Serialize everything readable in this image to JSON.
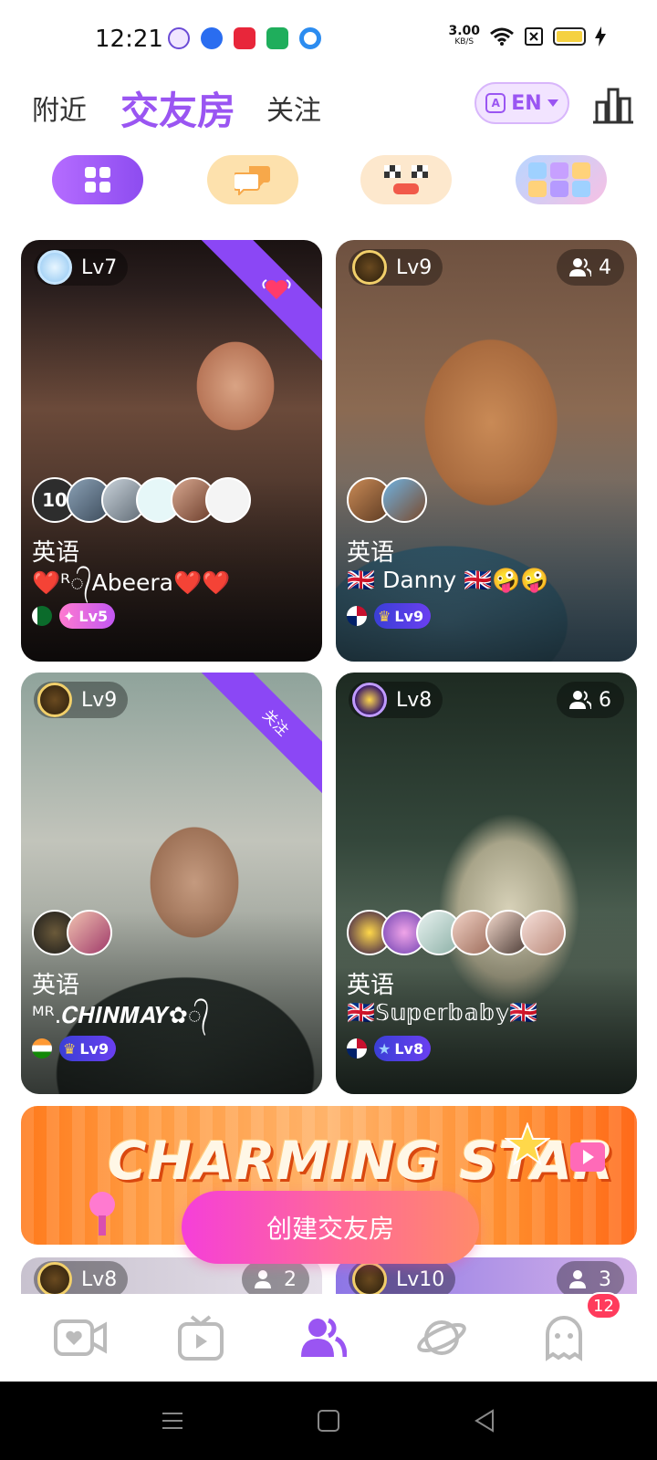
{
  "status_bar": {
    "time": "12:21",
    "net_speed": "3.00",
    "net_unit": "KB/S",
    "icons": [
      "app-notification-icon",
      "baidu-icon",
      "video-app-icon",
      "shield-app-icon",
      "chat-app-icon",
      "wifi-icon",
      "sim-icon",
      "battery-icon",
      "charging-icon"
    ]
  },
  "top_nav": {
    "tabs": [
      {
        "label": "附近"
      },
      {
        "label": "交友房"
      },
      {
        "label": "关注"
      }
    ],
    "active_tab": "交友房",
    "language_label": "EN",
    "accent_color": "#9a55f2"
  },
  "chips": [
    {
      "icon": "grid-icon"
    },
    {
      "icon": "chat-bubbles-icon"
    },
    {
      "icon": "racing-flags-icon"
    },
    {
      "icon": "number-puzzle-icon"
    }
  ],
  "rooms": [
    {
      "level": "Lv7",
      "ribbon": "",
      "members_overflow": "10",
      "language": "英语",
      "name": "❤️ᴿ᭄Abeera❤️❤️",
      "host_level": "Lv5"
    },
    {
      "level": "Lv9",
      "count": "4",
      "language": "英语",
      "name": "🇬🇧 Danny 🇬🇧🤪🤪",
      "host_level": "Lv9"
    },
    {
      "level": "Lv9",
      "ribbon": "关注",
      "language": "英语",
      "name": "ᴹᴿ.𝑪𝑯𝑰𝑵𝑴𝑨𝒀✿᭄",
      "host_level": "Lv9"
    },
    {
      "level": "Lv8",
      "count": "6",
      "language": "英语",
      "name": "🇬🇧𝕊𝕦𝕡𝕖𝕣𝕓𝕒𝕓𝕪🇬🇧",
      "host_level": "Lv8"
    }
  ],
  "banner": {
    "title": "CHARMING STAR"
  },
  "create_button": {
    "label": "创建交友房"
  },
  "partial_rooms": [
    {
      "level": "Lv8",
      "count": "2"
    },
    {
      "level": "Lv10",
      "count": "3"
    }
  ],
  "bottom_nav": {
    "items": [
      {
        "icon": "video-call-icon"
      },
      {
        "icon": "tv-icon"
      },
      {
        "icon": "people-icon"
      },
      {
        "icon": "planet-icon"
      },
      {
        "icon": "ghost-icon"
      }
    ],
    "active": "people-icon",
    "messages_badge": "12"
  }
}
